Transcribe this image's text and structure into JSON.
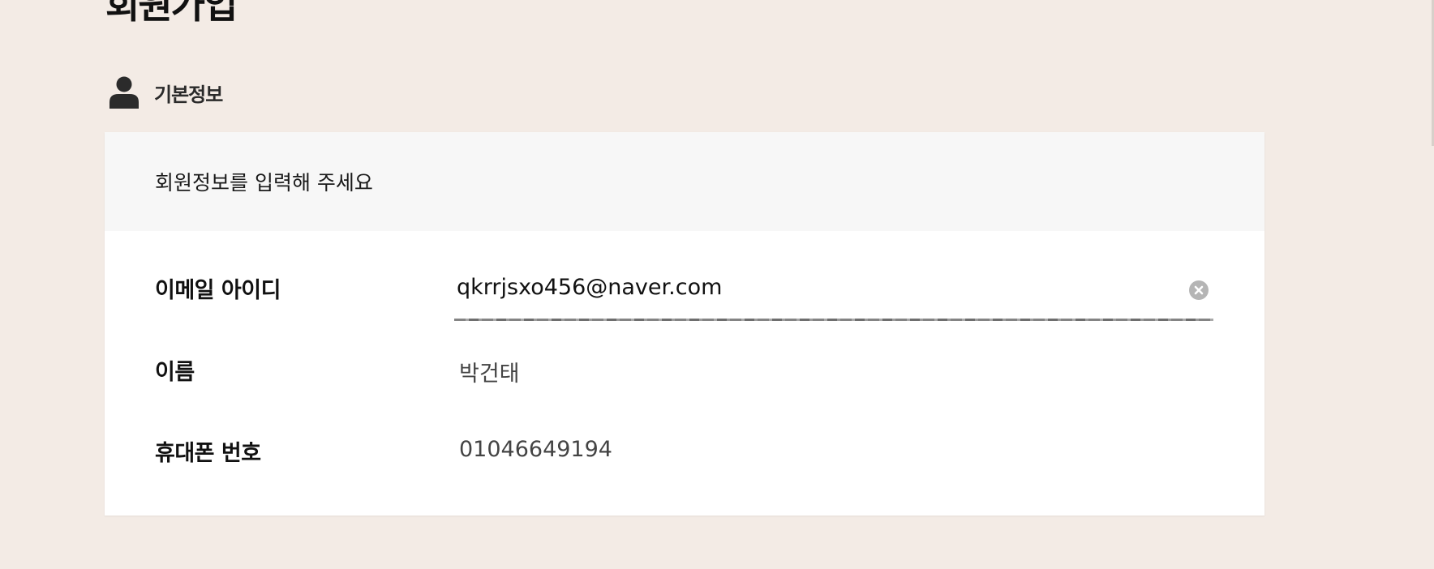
{
  "page": {
    "title": "회원가입"
  },
  "section": {
    "icon": "person-icon",
    "label": "기본정보"
  },
  "form": {
    "header": "회원정보를 입력해 주세요",
    "email": {
      "label": "이메일 아이디",
      "value": "qkrrjsxo456@naver.com",
      "clear_icon": "clear-icon"
    },
    "name": {
      "label": "이름",
      "value": "박건태"
    },
    "phone": {
      "label": "휴대폰 번호",
      "value": "01046649194"
    }
  },
  "colors": {
    "background": "#f3ebe5",
    "panel": "#ffffff",
    "panel_header": "#f7f7f7",
    "clear_button": "#b5b5b5"
  }
}
